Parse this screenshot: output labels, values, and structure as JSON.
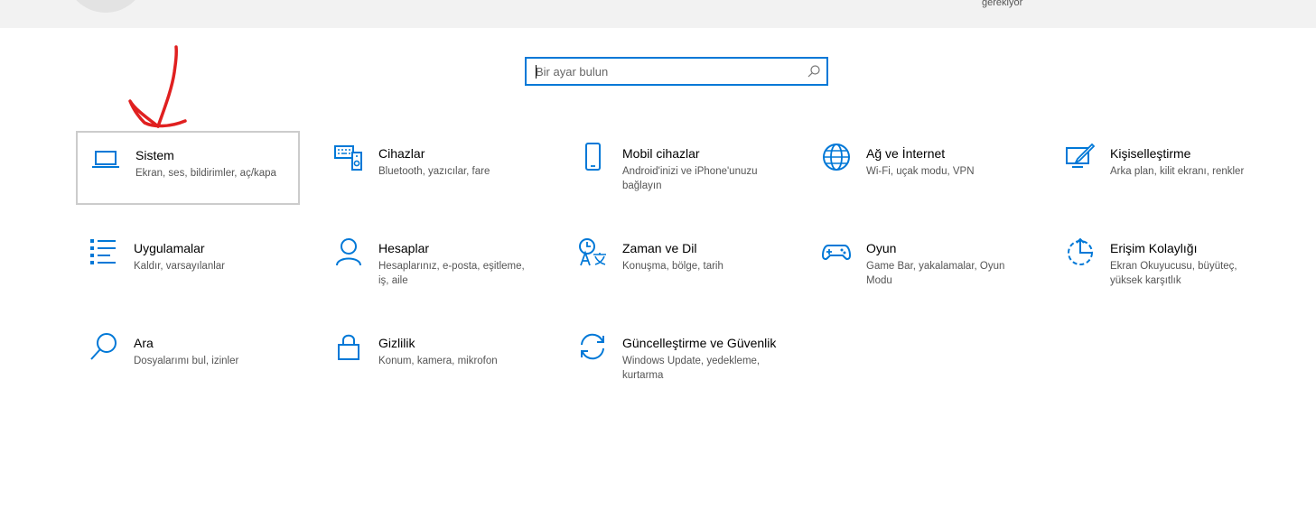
{
  "header": {
    "note": "gerekiyor"
  },
  "search": {
    "placeholder": "Bir ayar bulun"
  },
  "tiles": [
    {
      "title": "Sistem",
      "desc": "Ekran, ses, bildirimler, aç/kapa"
    },
    {
      "title": "Cihazlar",
      "desc": "Bluetooth, yazıcılar, fare"
    },
    {
      "title": "Mobil cihazlar",
      "desc": "Android'inizi ve iPhone'unuzu bağlayın"
    },
    {
      "title": "Ağ ve İnternet",
      "desc": "Wi-Fi, uçak modu, VPN"
    },
    {
      "title": "Kişiselleştirme",
      "desc": "Arka plan, kilit ekranı, renkler"
    },
    {
      "title": "Uygulamalar",
      "desc": "Kaldır, varsayılanlar"
    },
    {
      "title": "Hesaplar",
      "desc": "Hesaplarınız, e-posta, eşitleme, iş, aile"
    },
    {
      "title": "Zaman ve Dil",
      "desc": "Konuşma, bölge, tarih"
    },
    {
      "title": "Oyun",
      "desc": "Game Bar, yakalamalar, Oyun Modu"
    },
    {
      "title": "Erişim Kolaylığı",
      "desc": "Ekran Okuyucusu, büyüteç, yüksek karşıtlık"
    },
    {
      "title": "Ara",
      "desc": "Dosyalarımı bul, izinler"
    },
    {
      "title": "Gizlilik",
      "desc": "Konum, kamera, mikrofon"
    },
    {
      "title": "Güncelleştirme ve Güvenlik",
      "desc": "Windows Update, yedekleme, kurtarma"
    }
  ],
  "colors": {
    "accent": "#0078d7",
    "annotation": "#e02020",
    "selected_border": "#cccccc"
  },
  "icons": [
    "laptop-icon",
    "devices-icon",
    "phone-icon",
    "globe-icon",
    "personalization-icon",
    "apps-icon",
    "person-icon",
    "time-language-icon",
    "gamepad-icon",
    "accessibility-icon",
    "search-icon",
    "lock-icon",
    "update-icon"
  ]
}
